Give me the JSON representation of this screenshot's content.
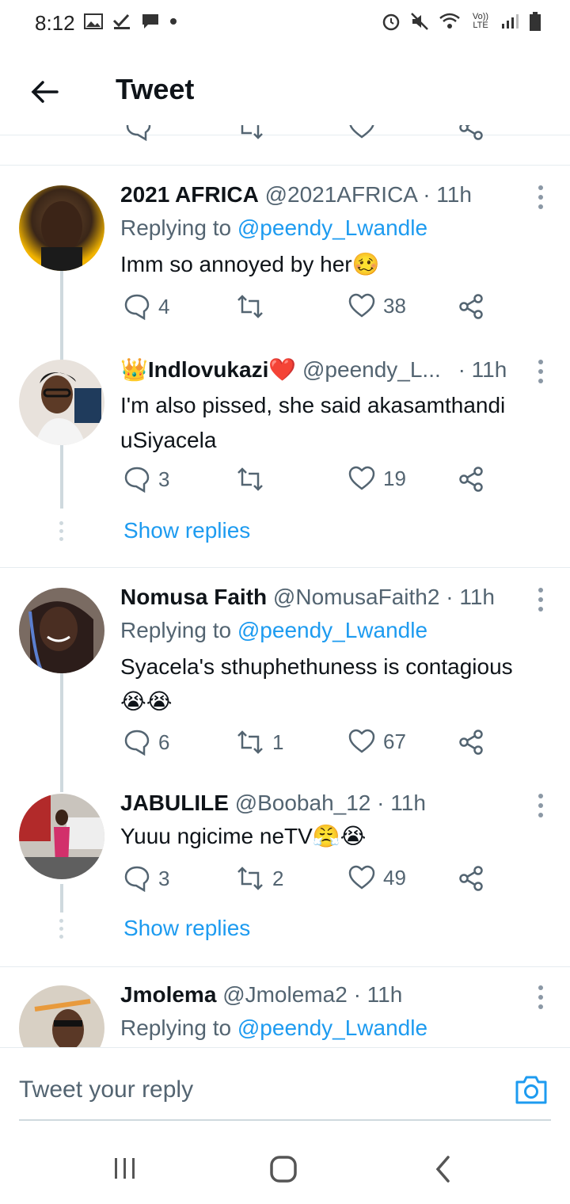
{
  "status_bar": {
    "time": "8:12",
    "network_label": "Vo)) LTE"
  },
  "header": {
    "title": "Tweet"
  },
  "composer": {
    "placeholder": "Tweet your reply"
  },
  "tweets": [
    {
      "name": "2021 AFRICA",
      "handle": "@2021AFRICA",
      "time": "· 11h",
      "replying_prefix": "Replying to ",
      "replying_handle": "@peendy_Lwandle",
      "text": "Imm so annoyed by her",
      "emoji": "🥴",
      "replies": "4",
      "retweets": "",
      "likes": "38"
    },
    {
      "name": "Indlovukazi",
      "name_prefix_emoji": "👑",
      "name_suffix_emoji": "❤️",
      "handle": "@peendy_L...",
      "time": "· 11h",
      "text": "I'm also pissed, she said akasamthandi uSiyacela",
      "replies": "3",
      "retweets": "",
      "likes": "19",
      "show_replies": "Show replies"
    },
    {
      "name": "Nomusa Faith",
      "handle": "@NomusaFaith2",
      "time": "· 11h",
      "replying_prefix": "Replying to ",
      "replying_handle": "@peendy_Lwandle",
      "text": "Syacela's sthuphethuness is contagious",
      "emoji": "😭😭",
      "replies": "6",
      "retweets": "1",
      "likes": "67"
    },
    {
      "name": "JABULILE",
      "handle": "@Boobah_12",
      "time": "· 11h",
      "text": "Yuuu ngicime neTV",
      "emoji": "😤😭",
      "replies": "3",
      "retweets": "2",
      "likes": "49",
      "show_replies": "Show replies"
    },
    {
      "name": "Jmolema",
      "handle": "@Jmolema2",
      "time": "· 11h",
      "replying_prefix": "Replying to ",
      "replying_handle": "@peendy_Lwandle"
    }
  ],
  "icons": {
    "reply": "speech-bubble-icon",
    "retweet": "retweet-icon",
    "like": "heart-icon",
    "share": "share-icon",
    "more": "more-vertical-icon",
    "camera": "camera-icon",
    "back": "arrow-left-icon"
  },
  "colors": {
    "link": "#1d9bf0",
    "secondary": "#536471",
    "divider": "#e6ecf0"
  }
}
